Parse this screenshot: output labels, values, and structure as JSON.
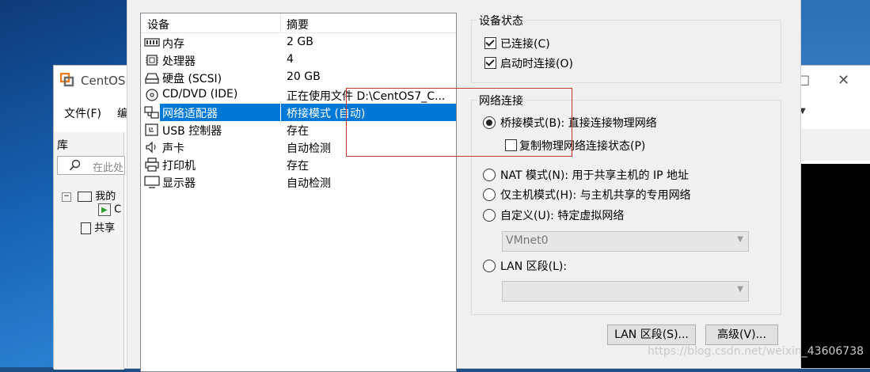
{
  "background_window": {
    "app_name": "CentOS",
    "menu_file": "文件(F)",
    "menu_extra": "编",
    "library_title": "库",
    "search_placeholder": "在此处",
    "tree": [
      "我的",
      "C",
      "共享"
    ]
  },
  "device_list": {
    "col_device": "设备",
    "col_summary": "摘要",
    "rows": [
      {
        "name": "内存",
        "summary": "2 GB",
        "icon": "memory-icon"
      },
      {
        "name": "处理器",
        "summary": "4",
        "icon": "processor-icon"
      },
      {
        "name": "硬盘 (SCSI)",
        "summary": "20 GB",
        "icon": "hard-disk-icon"
      },
      {
        "name": "CD/DVD (IDE)",
        "summary": "正在使用文件 D:\\CentOS7_C...",
        "icon": "cd-dvd-icon"
      },
      {
        "name": "网络适配器",
        "summary": "桥接模式 (自动)",
        "icon": "network-adapter-icon",
        "selected": true
      },
      {
        "name": "USB 控制器",
        "summary": "存在",
        "icon": "usb-icon"
      },
      {
        "name": "声卡",
        "summary": "自动检测",
        "icon": "sound-icon"
      },
      {
        "name": "打印机",
        "summary": "存在",
        "icon": "printer-icon"
      },
      {
        "name": "显示器",
        "summary": "自动检测",
        "icon": "monitor-icon"
      }
    ]
  },
  "device_status": {
    "title": "设备状态",
    "connected": "已连接(C)",
    "connect_at_power_on": "启动时连接(O)"
  },
  "network": {
    "title": "网络连接",
    "bridged": "桥接模式(B): 直接连接物理网络",
    "replicate": "复制物理网络连接状态(P)",
    "nat": "NAT 模式(N): 用于共享主机的 IP 地址",
    "host_only": "仅主机模式(H): 与主机共享的专用网络",
    "custom": "自定义(U): 特定虚拟网络",
    "custom_value": "VMnet0",
    "lan_segment": "LAN 区段(L):",
    "lan_value": ""
  },
  "buttons": {
    "lan_segments": "LAN 区段(S)...",
    "advanced": "高级(V)..."
  },
  "watermark": "https://blog.csdn.net/weixin_43606738",
  "colors": {
    "selection": "#0078d7",
    "highlight_box": "#c0392b"
  }
}
